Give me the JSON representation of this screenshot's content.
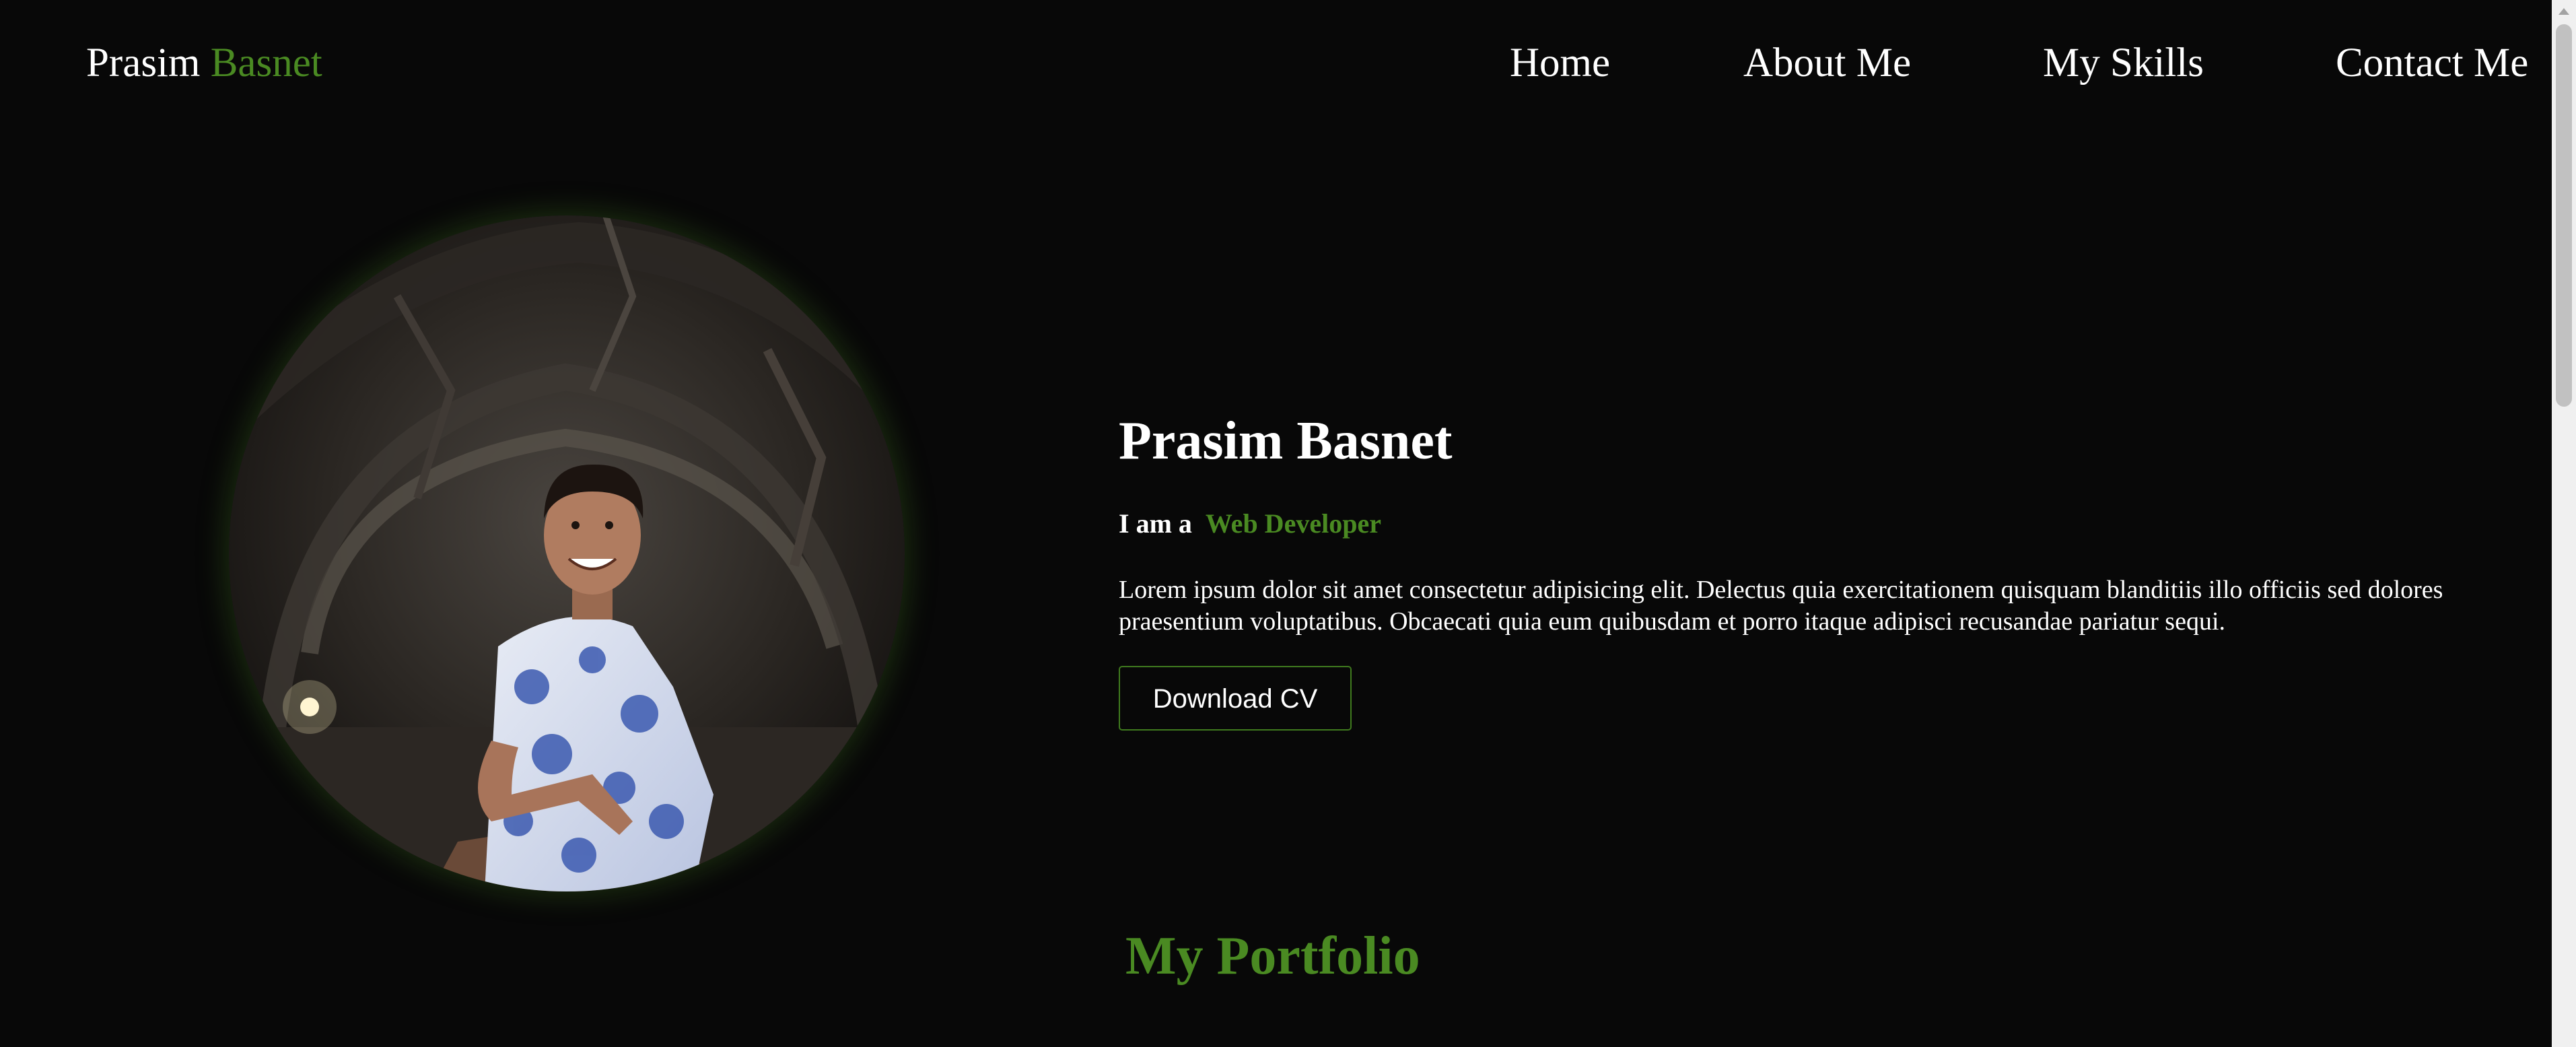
{
  "header": {
    "logo_first": "Prasim",
    "logo_last": "Basnet",
    "nav": {
      "home": "Home",
      "about": "About Me",
      "skills": "My Skills",
      "contact": "Contact Me"
    }
  },
  "hero": {
    "name": "Prasim Basnet",
    "tagline_prefix": "I am a",
    "role": "Web Developer",
    "description": "Lorem ipsum dolor sit amet consectetur adipisicing elit. Delectus quia exercitationem quisquam blanditiis illo officiis sed dolores praesentium voluptatibus. Obcaecati quia eum quibusdam et porro itaque adipisci recusandae pariatur sequi.",
    "download_cv": "Download CV"
  },
  "portfolio": {
    "title": "My Portfolio"
  },
  "colors": {
    "accent": "#4a8a22",
    "background": "#080808",
    "text": "#ffffff"
  },
  "icons": {
    "scroll_up": "triangle-up-icon"
  }
}
